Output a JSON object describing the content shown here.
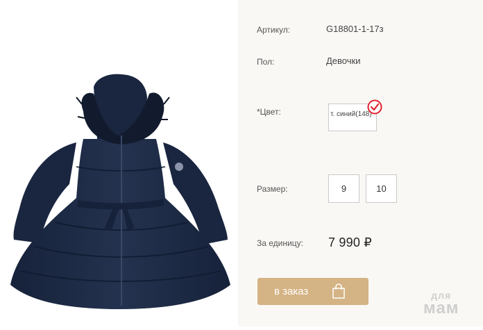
{
  "product": {
    "article_label": "Артикул:",
    "article_value": "G18801-1-17з",
    "gender_label": "Пол:",
    "gender_value": "Девочки",
    "color_label": "*Цвет:",
    "color_option": "т. синий(148)",
    "size_label": "Размер:",
    "sizes": [
      "9",
      "10"
    ],
    "price_label": "За единицу:",
    "price": "7 990 ₽",
    "order_button": "в заказ"
  },
  "watermark": {
    "line1": "для",
    "line2": "мам"
  },
  "colors": {
    "accent": "#d4b384",
    "panel": "#faf8f5",
    "check": "#e0202f",
    "jacket": "#1c2a45"
  },
  "icons": {
    "selected": "check-circle-icon",
    "cart": "shopping-bag-icon"
  }
}
